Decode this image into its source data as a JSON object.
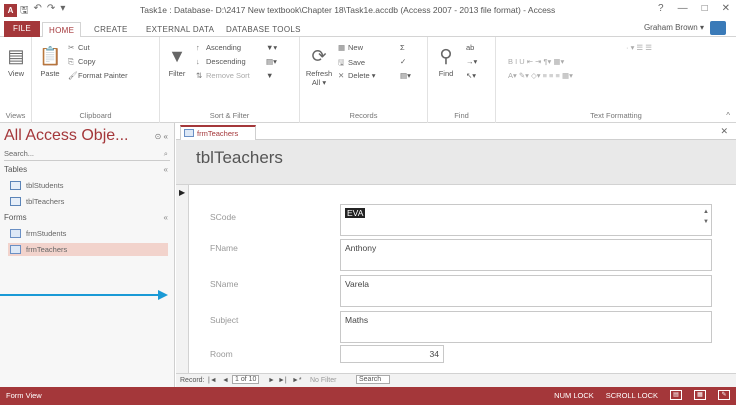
{
  "window": {
    "app_letter": "A",
    "title": "Task1e : Database- D:\\2417 New textbook\\Chapter 18\\Task1e.accdb (Access 2007 - 2013 file format) - Access",
    "help": "?",
    "minimize": "—",
    "maximize": "□",
    "close": "✕"
  },
  "ribbon_tabs": {
    "file": "FILE",
    "home": "HOME",
    "create": "CREATE",
    "external_data": "EXTERNAL DATA",
    "database_tools": "DATABASE TOOLS"
  },
  "user": {
    "name": "Graham Brown ▾"
  },
  "ribbon": {
    "views": {
      "view": "View",
      "label": "Views"
    },
    "clipboard": {
      "paste": "Paste",
      "cut": "Cut",
      "copy": "Copy",
      "format_painter": "Format Painter",
      "label": "Clipboard"
    },
    "sort_filter": {
      "filter": "Filter",
      "ascending": "Ascending",
      "descending": "Descending",
      "remove_sort": "Remove Sort",
      "label": "Sort & Filter"
    },
    "records": {
      "refresh": "Refresh All ▾",
      "new": "New",
      "save": "Save",
      "delete": "Delete ▾",
      "label": "Records"
    },
    "find": {
      "find": "Find",
      "label": "Find"
    },
    "text_formatting": {
      "label": "Text Formatting"
    }
  },
  "nav_pane": {
    "title": "All Access Obje...",
    "search_placeholder": "Search...",
    "tables_header": "Tables",
    "tables": [
      "tblStudents",
      "tblTeachers"
    ],
    "forms_header": "Forms",
    "forms": [
      "frmStudents",
      "frmTeachers"
    ]
  },
  "document": {
    "tab_label": "frmTeachers",
    "form_title": "tblTeachers",
    "fields": [
      {
        "label": "SCode",
        "value": "EVA"
      },
      {
        "label": "FName",
        "value": "Anthony"
      },
      {
        "label": "SName",
        "value": "Varela"
      },
      {
        "label": "Subject",
        "value": "Maths"
      },
      {
        "label": "Room",
        "value": "34"
      }
    ]
  },
  "record_nav": {
    "prefix": "Record:",
    "first": "|◄",
    "prev": "◄",
    "position": "1 of 10",
    "next": "►",
    "last": "►|",
    "new": "►*",
    "filter": "No Filter",
    "search": "Search"
  },
  "status": {
    "left": "Form View",
    "num_lock": "NUM LOCK",
    "scroll_lock": "SCROLL LOCK"
  },
  "colors": {
    "accent": "#a4373a",
    "annotation_arrow": "#1a9ad6"
  }
}
